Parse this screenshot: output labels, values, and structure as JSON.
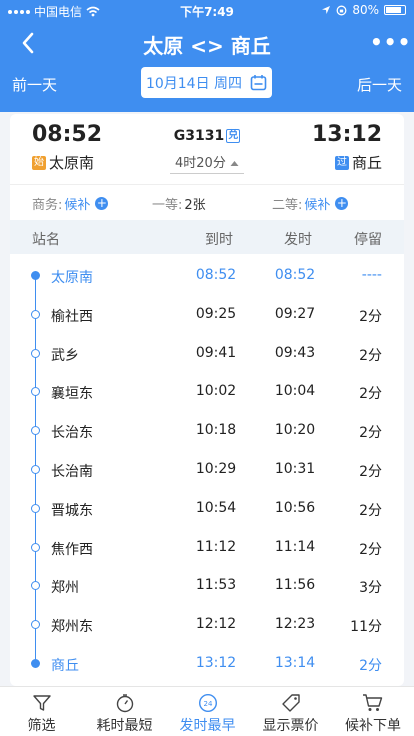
{
  "status_bar": {
    "carrier": "中国电信",
    "time": "下午7:49",
    "battery": "80%"
  },
  "nav": {
    "title": "太原 <> 商丘"
  },
  "day_nav": {
    "prev": "前一天",
    "next": "后一天",
    "date": "10月14日 周四"
  },
  "train": {
    "departure_time": "08:52",
    "arrival_time": "13:12",
    "departure_station": "太原南",
    "arrival_station": "商丘",
    "start_tag": "始",
    "pass_tag": "过",
    "number": "G3131",
    "exchange_tag": "兑",
    "duration": "4时20分"
  },
  "seats": {
    "business_label": "商务:",
    "business_value": "候补",
    "first_label": "一等:",
    "first_value": "2张",
    "second_label": "二等:",
    "second_value": "候补"
  },
  "table": {
    "headers": {
      "station": "站名",
      "arrive": "到时",
      "depart": "发时",
      "stay": "停留"
    },
    "rows": [
      {
        "station": "太原南",
        "arrive": "08:52",
        "depart": "08:52",
        "stay": "----"
      },
      {
        "station": "榆社西",
        "arrive": "09:25",
        "depart": "09:27",
        "stay": "2分"
      },
      {
        "station": "武乡",
        "arrive": "09:41",
        "depart": "09:43",
        "stay": "2分"
      },
      {
        "station": "襄垣东",
        "arrive": "10:02",
        "depart": "10:04",
        "stay": "2分"
      },
      {
        "station": "长治东",
        "arrive": "10:18",
        "depart": "10:20",
        "stay": "2分"
      },
      {
        "station": "长治南",
        "arrive": "10:29",
        "depart": "10:31",
        "stay": "2分"
      },
      {
        "station": "晋城东",
        "arrive": "10:54",
        "depart": "10:56",
        "stay": "2分"
      },
      {
        "station": "焦作西",
        "arrive": "11:12",
        "depart": "11:14",
        "stay": "2分"
      },
      {
        "station": "郑州",
        "arrive": "11:53",
        "depart": "11:56",
        "stay": "3分"
      },
      {
        "station": "郑州东",
        "arrive": "12:12",
        "depart": "12:23",
        "stay": "11分"
      },
      {
        "station": "商丘",
        "arrive": "13:12",
        "depart": "13:14",
        "stay": "2分"
      }
    ]
  },
  "tabbar": {
    "filter": "筛选",
    "shortest": "耗时最短",
    "earliest": "发时最早",
    "earliest_badge": "24",
    "show_price": "显示票价",
    "waitlist": "候补下单"
  },
  "colors": {
    "primary": "#3f8ef0",
    "start_tag": "#f0a030"
  }
}
